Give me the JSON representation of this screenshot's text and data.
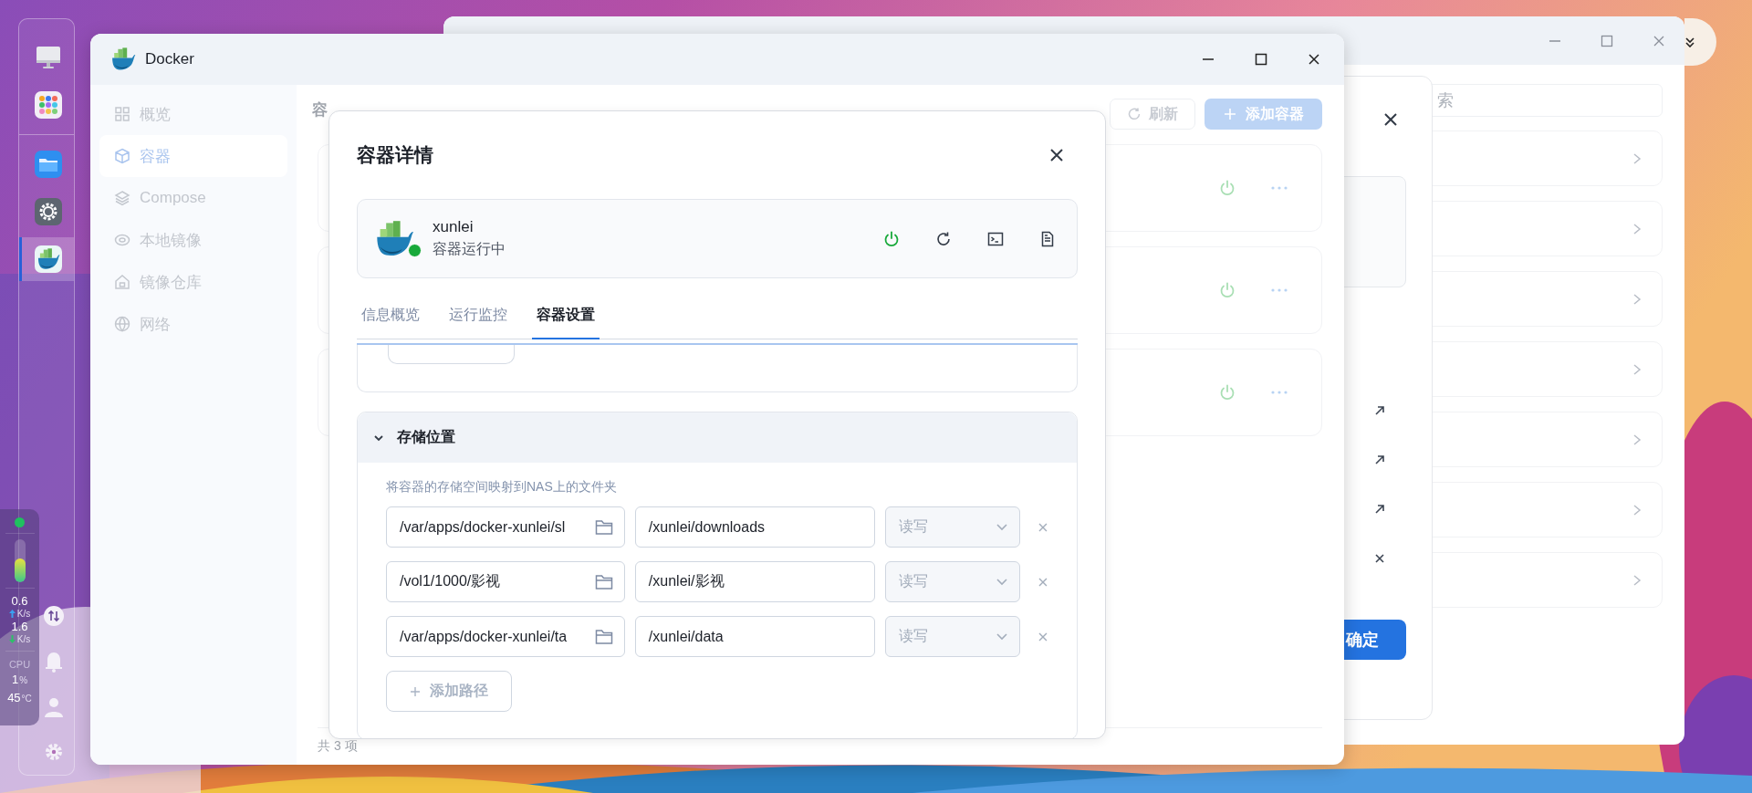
{
  "dock": {
    "apps": [
      {
        "kind": "monitor",
        "selected": false
      },
      {
        "kind": "apps",
        "selected": false
      },
      {
        "kind": "folder",
        "selected": false
      },
      {
        "kind": "settings",
        "selected": false
      },
      {
        "kind": "docker",
        "selected": true
      }
    ],
    "tools": [
      {
        "kind": "transfer"
      },
      {
        "kind": "bell"
      },
      {
        "kind": "user"
      },
      {
        "kind": "settings"
      }
    ]
  },
  "status_widget": {
    "gauge": {
      "level": 0.55
    },
    "upload": {
      "value": "0.6",
      "unit": "K/s"
    },
    "download": {
      "value": "1.6",
      "unit": "K/s"
    },
    "cpu_label": "CPU",
    "cpu_value": "1",
    "cpu_unit": "%",
    "temp_value": "45",
    "temp_unit": "°C"
  },
  "back_window": {
    "search": {
      "placeholder": "索"
    },
    "rows": [
      {
        "kind": "link"
      },
      {
        "kind": "link"
      },
      {
        "kind": "link"
      },
      {
        "kind": "link"
      },
      {
        "kind": "link"
      },
      {
        "kind": "link"
      },
      {
        "kind": "link"
      }
    ],
    "dialog": {
      "actions": [
        {
          "kind": "open"
        },
        {
          "kind": "open"
        },
        {
          "kind": "open"
        },
        {
          "kind": "remove"
        }
      ],
      "confirm_button": "确定"
    }
  },
  "docker_window": {
    "title": "Docker",
    "sidebar": [
      {
        "kind": "overview",
        "label": "概览",
        "selected": false
      },
      {
        "kind": "container",
        "label": "容器",
        "selected": true
      },
      {
        "kind": "compose",
        "label": "Compose",
        "selected": false
      },
      {
        "label": "本地镜像",
        "selected": false
      },
      {
        "kind": "registry",
        "label": "镜像仓库",
        "selected": false
      },
      {
        "kind": "network",
        "label": "网络",
        "selected": false
      }
    ],
    "heading": "容",
    "refresh_button": "刷新",
    "add_button": "添加容器",
    "containers": [
      {
        "running": true
      },
      {
        "running": true
      },
      {
        "running": true
      }
    ],
    "footer": "共 3 项"
  },
  "dialog": {
    "title": "容器详情",
    "container": {
      "name": "xunlei",
      "status": "容器运行中",
      "running": true
    },
    "tabs": [
      {
        "label": "信息概览",
        "selected": false
      },
      {
        "label": "运行监控",
        "selected": false
      },
      {
        "label": "容器设置",
        "selected": true
      }
    ],
    "storage": {
      "title": "存储位置",
      "expanded": true,
      "description": "将容器的存储空间映射到NAS上的文件夹",
      "mappings": [
        {
          "host": "/var/apps/docker-xunlei/sl",
          "container": "/xunlei/downloads",
          "mode": "读写",
          "disabled": true
        },
        {
          "host": "/vol1/1000/影视",
          "container": "/xunlei/影视",
          "mode": "读写",
          "disabled": true
        },
        {
          "host": "/var/apps/docker-xunlei/ta",
          "container": "/xunlei/data",
          "mode": "读写",
          "disabled": true
        }
      ],
      "add_button": "添加路径",
      "add_disabled": true
    }
  }
}
